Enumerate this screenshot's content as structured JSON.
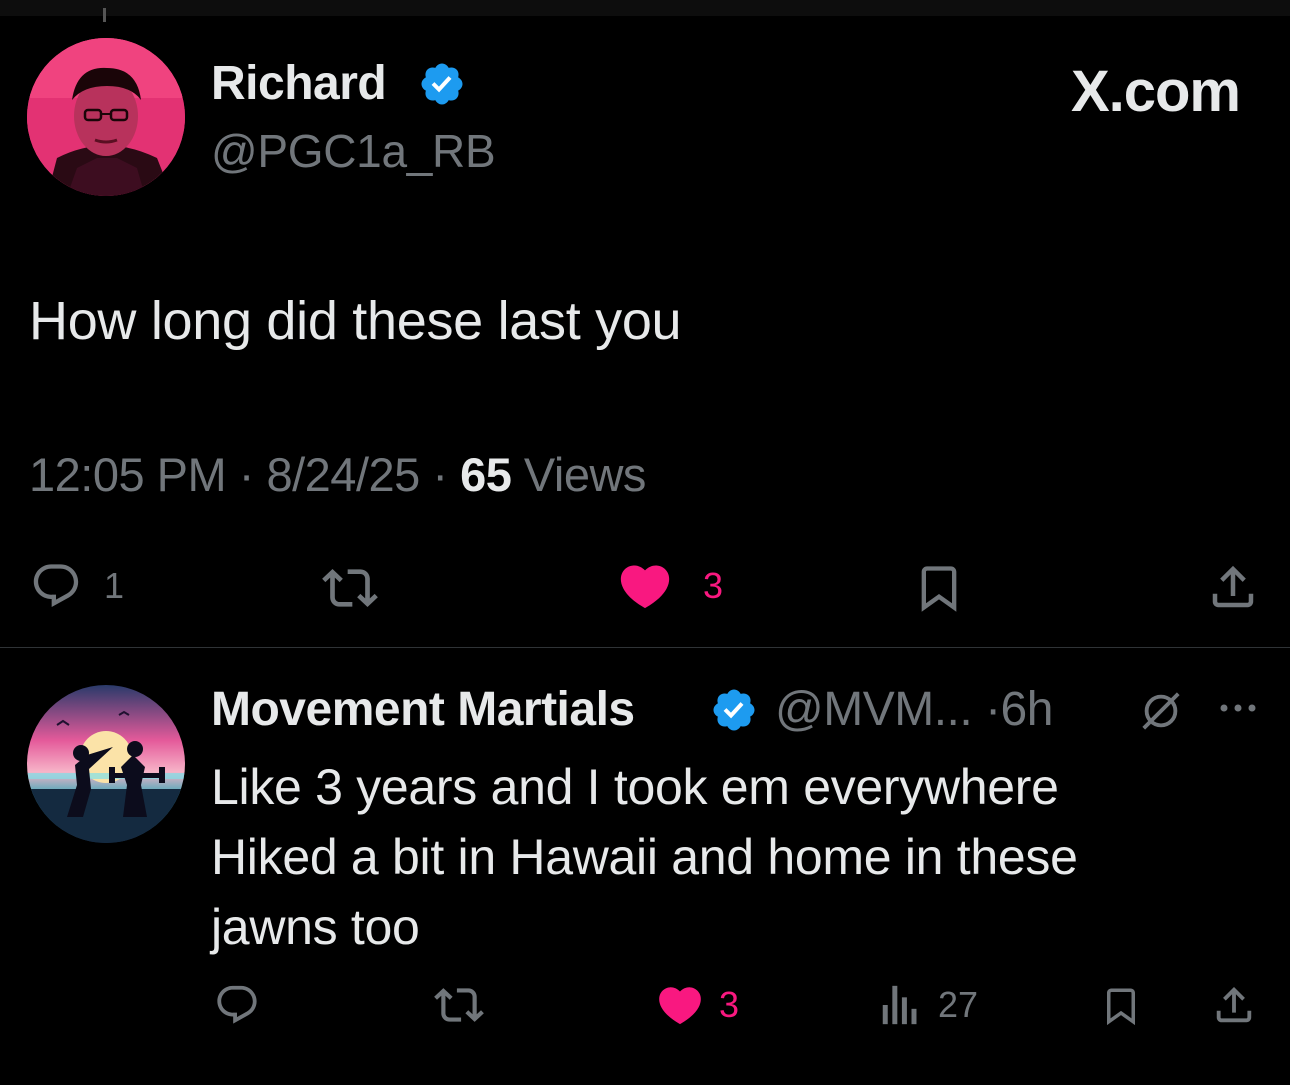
{
  "brand": "X.com",
  "main_tweet": {
    "author_name": "Richard",
    "author_handle": "@PGC1a_RB",
    "verified_icon": "verified-badge-icon",
    "text": "How long did these last you",
    "time": "12:05 PM",
    "date": "8/24/25",
    "views_count": "65",
    "views_label": "Views",
    "sep": "·",
    "actions": {
      "reply_count": "1",
      "retweet_count": "",
      "like_count": "3",
      "bookmark_count": ""
    }
  },
  "reply": {
    "author_name": "Movement Martials",
    "author_handle": "@MVM...",
    "time": "6h",
    "sep": "·",
    "lines": [
      "Like 3 years and I took em everywhere",
      "Hiked a bit in Hawaii and home in these",
      "jawns too"
    ],
    "actions": {
      "reply_count": "",
      "retweet_count": "",
      "like_count": "3",
      "views_count": "27"
    }
  },
  "colors": {
    "background": "#000000",
    "text": "#e7e9ea",
    "muted": "#71767b",
    "like": "#f91880",
    "verified": "#1d9bf0",
    "divider": "#2f3336"
  }
}
